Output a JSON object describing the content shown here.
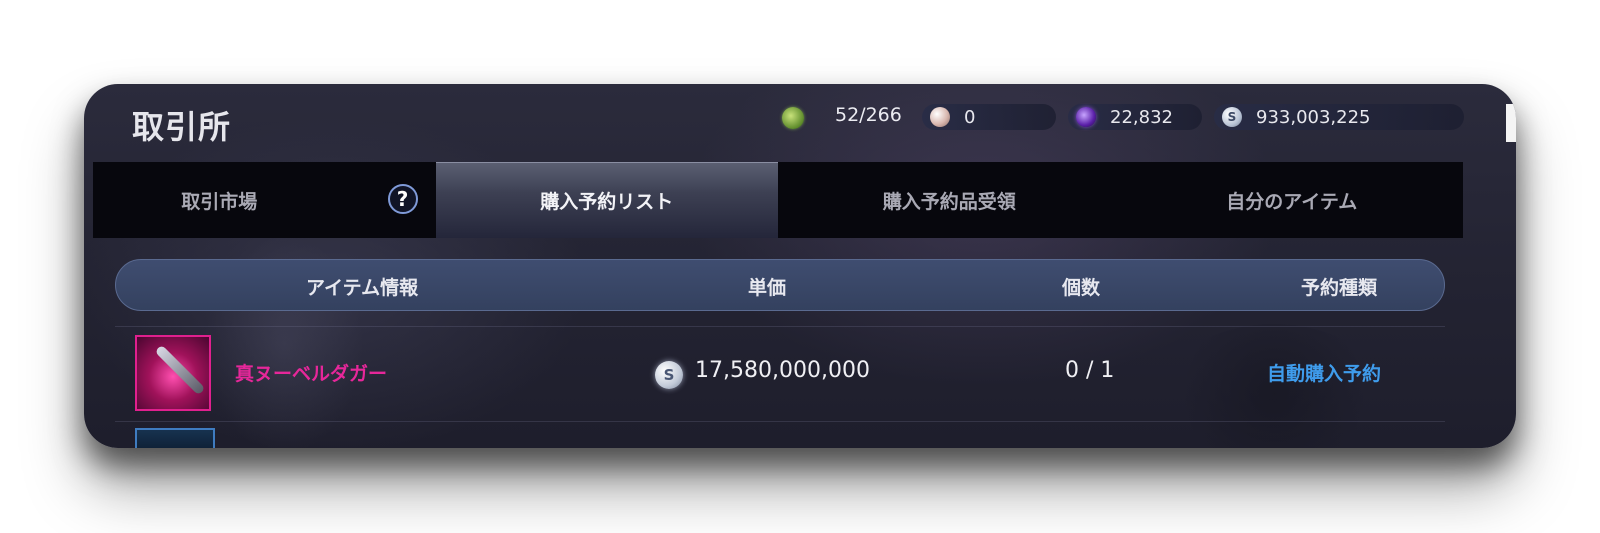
{
  "window": {
    "title": "取引所"
  },
  "currencies": {
    "energy": "52/266",
    "pearl": "0",
    "crystal": "22,832",
    "silver": "933,003,225",
    "silver_symbol": "S"
  },
  "tabs": [
    {
      "label": "取引市場",
      "active": false
    },
    {
      "label": "購入予約リスト",
      "active": true
    },
    {
      "label": "購入予約品受領",
      "active": false
    },
    {
      "label": "自分のアイテム",
      "active": false
    }
  ],
  "help_icon": "?",
  "table": {
    "headers": {
      "item": "アイテム情報",
      "price": "単価",
      "qty": "個数",
      "type": "予約種類"
    },
    "rows": [
      {
        "name": "真ヌーベルダガー",
        "price": "17,580,000,000",
        "qty": "0 / 1",
        "type": "自動購入予約",
        "price_symbol": "S"
      }
    ]
  },
  "colors": {
    "item_name": "#e6279a",
    "reservation_type": "#3f9cec",
    "active_tab": "#3d4053"
  }
}
